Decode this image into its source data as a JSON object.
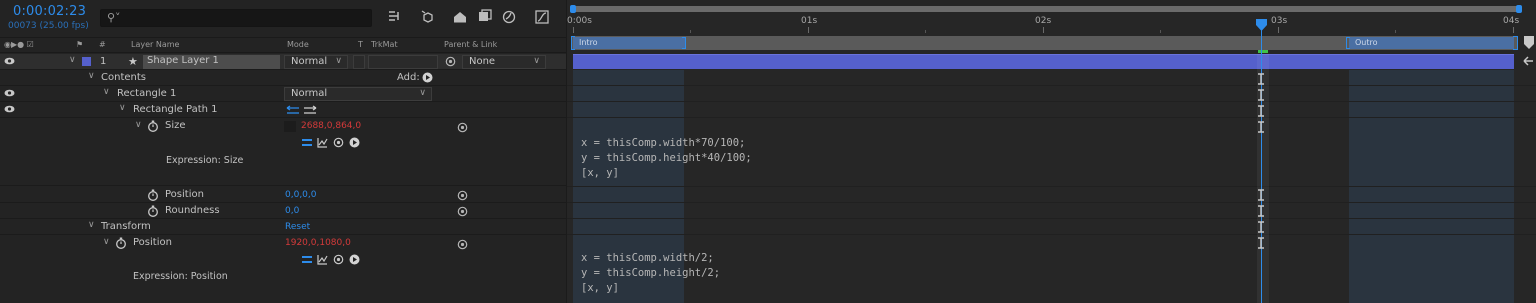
{
  "timecode": "0:00:02:23",
  "frames_fps": "00073 (25.00 fps)",
  "search": {
    "placeholder": ""
  },
  "columns": {
    "layer_name": "Layer Name",
    "mode": "Mode",
    "t": "T",
    "trkmat": "TrkMat",
    "parent_link": "Parent & Link",
    "hash": "#"
  },
  "layer": {
    "number": "1",
    "name": "Shape Layer 1",
    "mode": "Normal",
    "parent": "None"
  },
  "tree": {
    "contents": "Contents",
    "add_label": "Add:",
    "rectangle": "Rectangle 1",
    "rectangle_mode": "Normal",
    "rect_path": "Rectangle Path 1",
    "size_label": "Size",
    "size_value": "2688,0,864,0",
    "expr_size_label": "Expression: Size",
    "position_label": "Position",
    "position_value": "0,0,0,0",
    "roundness_label": "Roundness",
    "roundness_value": "0,0",
    "transform": "Transform",
    "reset": "Reset",
    "tposition_label": "Position",
    "tposition_value": "1920,0,1080,0",
    "expr_position_label": "Expression: Position"
  },
  "ruler": {
    "labels": [
      "0:00s",
      "01s",
      "02s",
      "03s",
      "04s"
    ]
  },
  "markers": {
    "intro": "Intro",
    "outro": "Outro"
  },
  "expressions": {
    "size": "x = thisComp.width*70/100;\ny = thisComp.height*40/100;\n[x, y]",
    "position": "x = thisComp.width/2;\ny = thisComp.height/2;\n[x, y]"
  },
  "colors": {
    "timecode": "#2d8ceb",
    "layer_bar": "#5560cc",
    "marker": "#4a6fa3",
    "keyframe_value": "#d43a3a",
    "link_value": "#2d8ceb",
    "cti": "#2d8ceb"
  }
}
